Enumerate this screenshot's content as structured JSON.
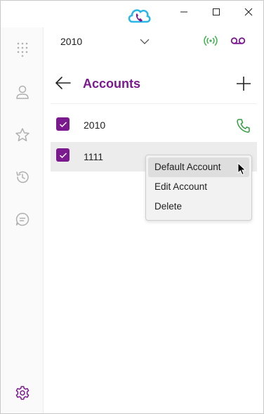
{
  "header": {
    "selected_account": "2010"
  },
  "accounts_page": {
    "title": "Accounts"
  },
  "accounts": [
    {
      "label": "2010",
      "checked": true
    },
    {
      "label": "1111",
      "checked": true
    }
  ],
  "context_menu": {
    "items": [
      "Default Account",
      "Edit Account",
      "Delete"
    ],
    "highlighted": "Default Account"
  },
  "colors": {
    "accent": "#7b1a8f",
    "call_green": "#2e9e3e",
    "signal_green": "#3cb44b"
  },
  "icons": {
    "sidebar": [
      "dialpad-icon",
      "contacts-icon",
      "favorites-icon",
      "history-icon",
      "chat-icon",
      "settings-icon"
    ]
  }
}
